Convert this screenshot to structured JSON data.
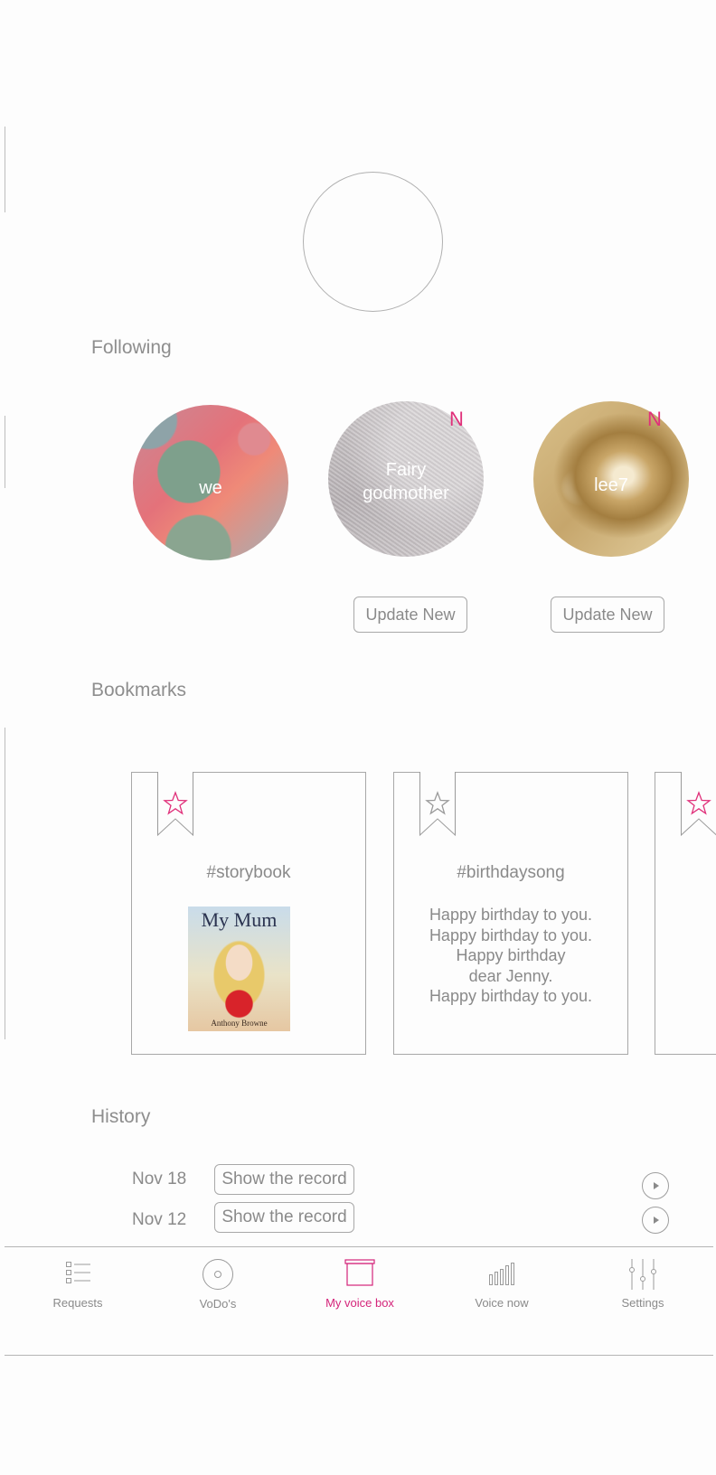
{
  "profile": {
    "avatar": "avatar-placeholder"
  },
  "following": {
    "title": "Following",
    "people": [
      {
        "name": "we",
        "is_new": false
      },
      {
        "name": "Fairy godmother",
        "is_new": true,
        "badge": "N",
        "action": "Update New"
      },
      {
        "name": "lee7",
        "is_new": true,
        "badge": "N",
        "action": "Update New"
      }
    ]
  },
  "bookmarks": {
    "title": "Bookmarks",
    "cards": [
      {
        "tag": "#storybook",
        "book_title": "My Mum",
        "book_author": "Anthony Browne",
        "star_color": "#e0307a"
      },
      {
        "tag": "#birthdaysong",
        "lyrics": [
          "Happy birthday to you.",
          "Happy birthday to you.",
          "Happy birthday",
          "dear Jenny.",
          "Happy birthday to you."
        ],
        "star_color": "#9a9a9a"
      },
      {
        "star_color": "#e0307a"
      }
    ]
  },
  "history": {
    "title": "History",
    "items": [
      {
        "date": "Nov 18",
        "action": "Show the record"
      },
      {
        "date": "Nov 12",
        "action": "Show the record"
      }
    ]
  },
  "nav": {
    "items": [
      {
        "label": "Requests",
        "icon": "list-icon"
      },
      {
        "label": "VoDo's",
        "icon": "disc-icon"
      },
      {
        "label": "My voice box",
        "icon": "box-icon",
        "active": true
      },
      {
        "label": "Voice now",
        "icon": "bars-icon"
      },
      {
        "label": "Settings",
        "icon": "sliders-icon"
      }
    ]
  },
  "colors": {
    "accent": "#d4247a",
    "text": "#8a8a8a",
    "border": "#a8a8a8"
  }
}
